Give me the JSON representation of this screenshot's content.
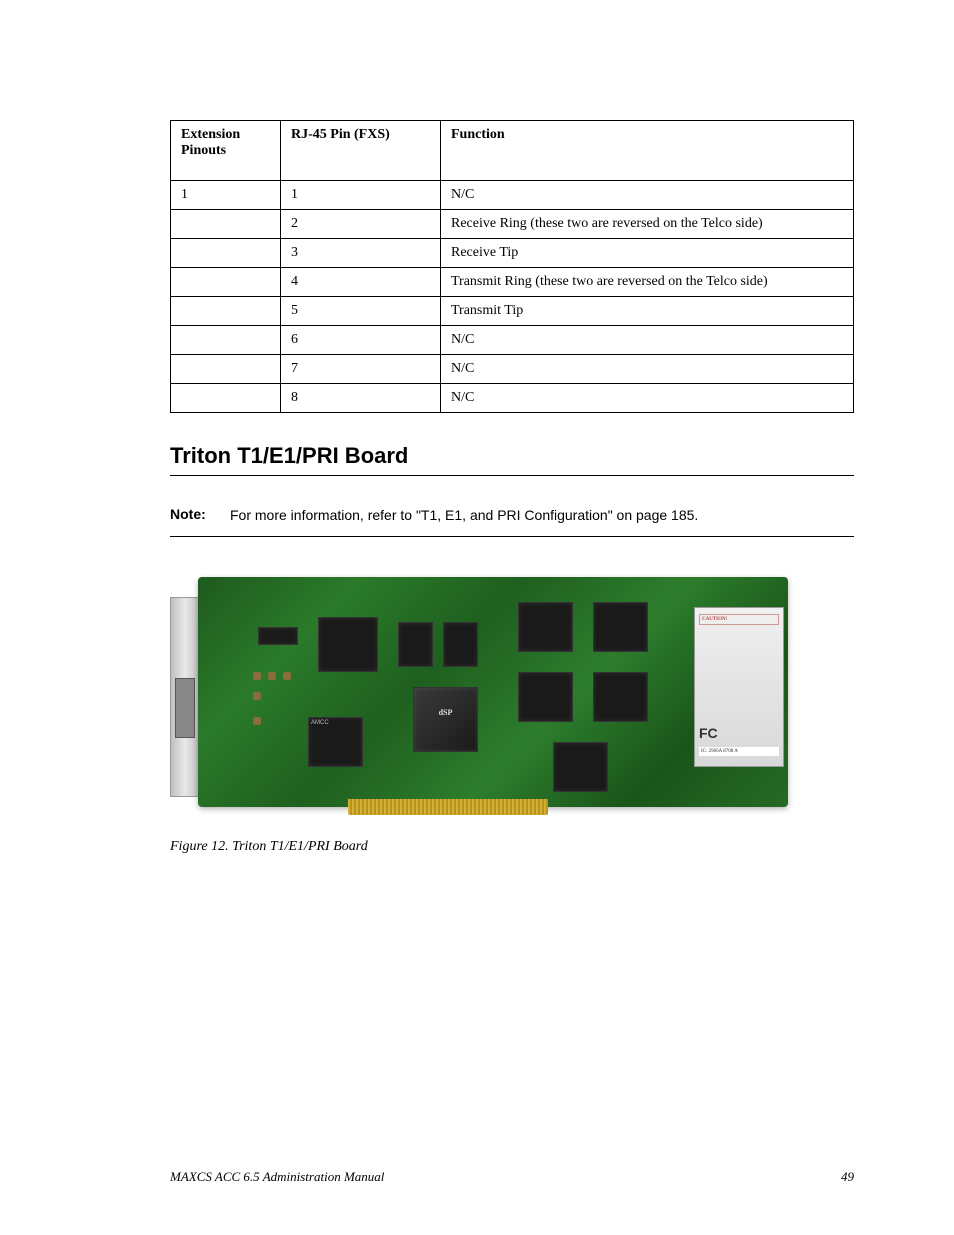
{
  "table": {
    "headers": [
      "Extension Pinouts",
      "RJ-45 Pin (FXS)",
      "Function"
    ],
    "rows": [
      [
        "1",
        "1",
        "N/C"
      ],
      [
        "",
        "2",
        "Receive Ring (these two are reversed on the Telco side)"
      ],
      [
        "",
        "3",
        "Receive Tip"
      ],
      [
        "",
        "4",
        "Transmit Ring (these two are reversed on the Telco side)"
      ],
      [
        "",
        "5",
        "Transmit Tip"
      ],
      [
        "",
        "6",
        "N/C"
      ],
      [
        "",
        "7",
        "N/C"
      ],
      [
        "",
        "8",
        "N/C"
      ]
    ]
  },
  "heading": "Triton T1/E1/PRI Board",
  "note": {
    "label": "Note:",
    "text": "For more information, refer to \"T1, E1, and PRI Configuration\" on page 185."
  },
  "figure_caption": "Figure 12. Triton T1/E1/PRI Board",
  "footer": {
    "left": "MAXCS ACC 6.5 Administration Manual",
    "right": "49"
  }
}
